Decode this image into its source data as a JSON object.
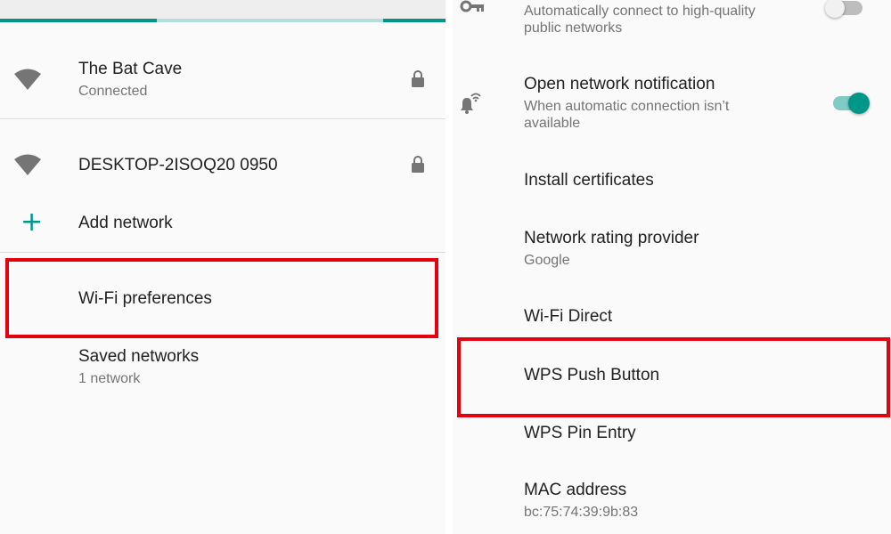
{
  "colors": {
    "accent": "#009688",
    "highlight_box": "#e4000f",
    "text_primary": "#212121",
    "text_secondary": "#757575"
  },
  "left": {
    "networks": [
      {
        "name": "The Bat Cave",
        "status": "Connected",
        "icon": "wifi-icon",
        "lock": "lock-icon"
      },
      {
        "name": "DESKTOP-2ISOQ20 0950",
        "icon": "wifi-icon",
        "lock": "lock-icon"
      }
    ],
    "add_network": {
      "label": "Add network",
      "icon": "plus-icon"
    },
    "wifi_preferences": {
      "label": "Wi-Fi preferences"
    },
    "saved_networks": {
      "label": "Saved networks",
      "count": "1 network"
    }
  },
  "right": {
    "auto_connect": {
      "description_line1": "Automatically connect to high-quality",
      "description_line2": "public networks",
      "icon": "key-icon",
      "enabled": false
    },
    "open_network_notification": {
      "title": "Open network notification",
      "description_line1": "When automatic connection isn’t",
      "description_line2": "available",
      "icon": "bell-wifi-icon",
      "enabled": true
    },
    "install_certificates": {
      "label": "Install certificates"
    },
    "network_rating_provider": {
      "label": "Network rating provider",
      "value": "Google"
    },
    "wifi_direct": {
      "label": "Wi-Fi Direct"
    },
    "wps_push_button": {
      "label": "WPS Push Button"
    },
    "wps_pin_entry": {
      "label": "WPS Pin Entry"
    },
    "mac_address": {
      "label": "MAC address",
      "value": "bc:75:74:39:9b:83"
    }
  }
}
